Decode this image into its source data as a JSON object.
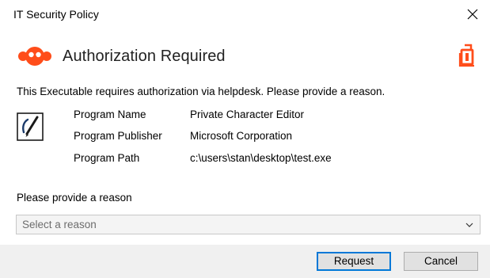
{
  "window": {
    "title": "IT Security Policy"
  },
  "icons": {
    "close": "close-icon",
    "brand_logo": "brand-logo-icon",
    "corner_logo": "corner-logo-icon",
    "program": "program-edit-icon",
    "dropdown": "chevron-down-icon"
  },
  "colors": {
    "accent": "#ff4d1a",
    "button_focus_border": "#0078d7",
    "footer_bg": "#f0f0f0",
    "select_bg": "#f4f4f4"
  },
  "header": {
    "title": "Authorization Required"
  },
  "description": "This Executable requires authorization via helpdesk. Please provide a reason.",
  "program_info": {
    "name_label": "Program Name",
    "name_value": "Private Character Editor",
    "publisher_label": "Program Publisher",
    "publisher_value": "Microsoft Corporation",
    "path_label": "Program Path",
    "path_value": "c:\\users\\stan\\desktop\\test.exe"
  },
  "reason": {
    "label": "Please provide a reason",
    "selected": "Select a reason"
  },
  "buttons": {
    "request": "Request",
    "cancel": "Cancel"
  }
}
